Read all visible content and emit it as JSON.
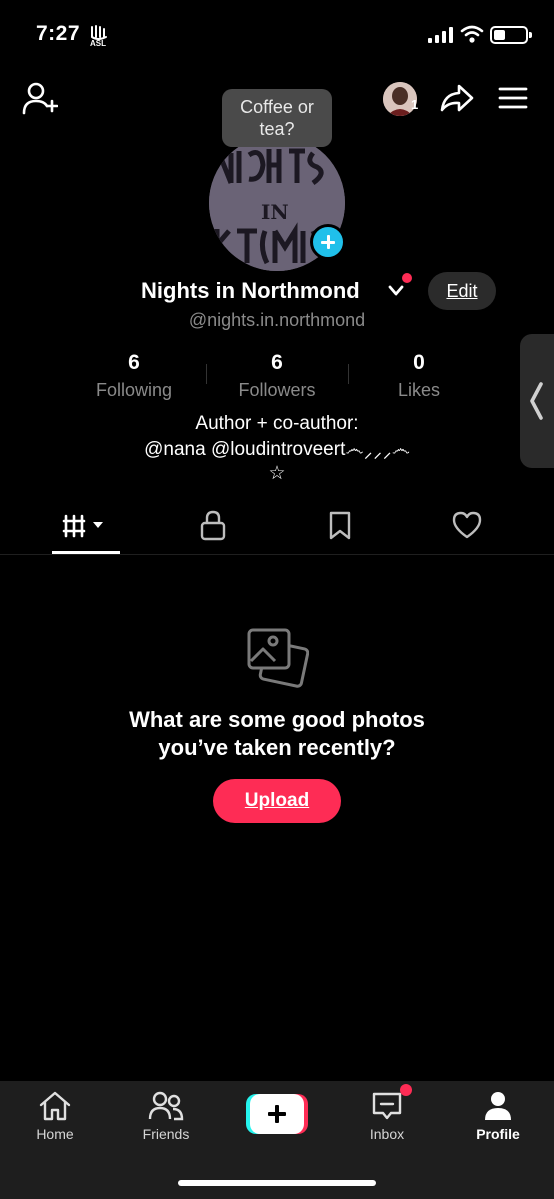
{
  "status_bar": {
    "time": "7:27",
    "battery_level": 0.35
  },
  "tooltip": {
    "text": "Coffee or tea?"
  },
  "profile": {
    "avatar_text": "NIGHTS IN NORTHMOND",
    "friend_request_count": "1",
    "name": "Nights in Northmond",
    "handle": "@nights.in.northmond",
    "edit_label": "Edit"
  },
  "stats": [
    {
      "value": "6",
      "label": "Following"
    },
    {
      "value": "6",
      "label": "Followers"
    },
    {
      "value": "0",
      "label": "Likes"
    }
  ],
  "bio": {
    "line1": "Author + co-author:",
    "line2": "@nana @loudintroveert෴⸝⸝⸝෴",
    "line3": "☆"
  },
  "tabs": [
    {
      "icon": "grid-icon",
      "active": true
    },
    {
      "icon": "lock-icon",
      "active": false
    },
    {
      "icon": "bookmark-icon",
      "active": false
    },
    {
      "icon": "heart-icon",
      "active": false
    }
  ],
  "empty_state": {
    "title_line1": "What are some good photos",
    "title_line2": "you’ve taken recently?",
    "upload_label": "Upload"
  },
  "bottom_nav": [
    {
      "label": "Home",
      "icon": "home-icon"
    },
    {
      "label": "Friends",
      "icon": "friends-icon"
    },
    {
      "label": "",
      "icon": "create-icon"
    },
    {
      "label": "Inbox",
      "icon": "inbox-icon"
    },
    {
      "label": "Profile",
      "icon": "profile-icon"
    }
  ],
  "colors": {
    "accent": "#fe2c55",
    "cyan": "#25f4ee",
    "blue_badge": "#20c0ea",
    "muted_text": "#8a8a8a"
  }
}
